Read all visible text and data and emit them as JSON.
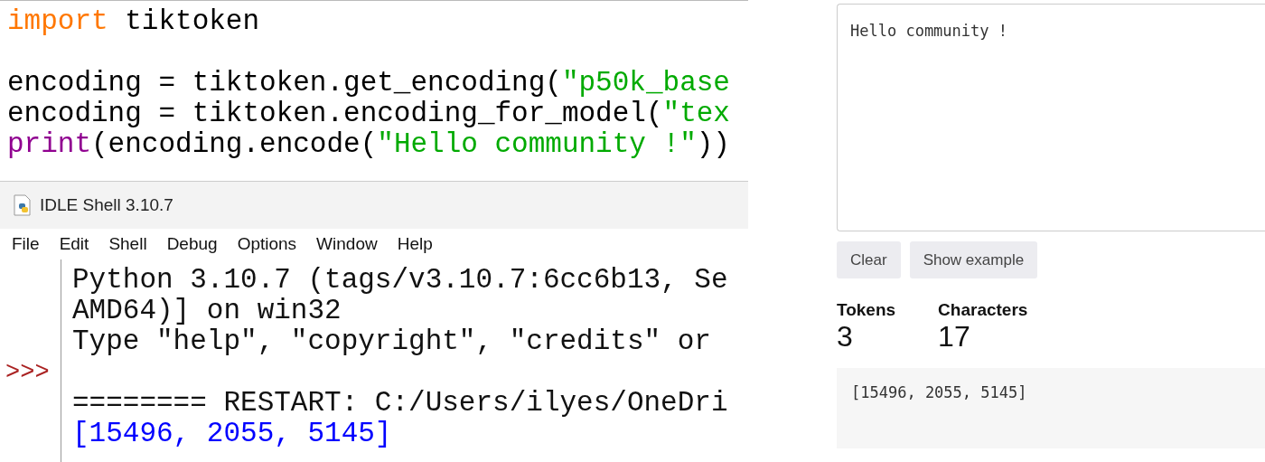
{
  "editor": {
    "lines": [
      {
        "kind": "code",
        "tokens": [
          {
            "kind": "keyword",
            "text": "import"
          },
          {
            "kind": "plain",
            "text": " tiktoken"
          }
        ]
      },
      {
        "kind": "blank"
      },
      {
        "kind": "code",
        "tokens": [
          {
            "kind": "plain",
            "text": "encoding = tiktoken.get_encoding("
          },
          {
            "kind": "string",
            "text": "\"p50k_base"
          }
        ]
      },
      {
        "kind": "code",
        "tokens": [
          {
            "kind": "plain",
            "text": "encoding = tiktoken.encoding_for_model("
          },
          {
            "kind": "string",
            "text": "\"tex"
          }
        ]
      },
      {
        "kind": "code",
        "tokens": [
          {
            "kind": "builtin",
            "text": "print"
          },
          {
            "kind": "plain",
            "text": "(encoding.encode("
          },
          {
            "kind": "string",
            "text": "\"Hello community !\""
          },
          {
            "kind": "plain",
            "text": "))"
          }
        ]
      }
    ]
  },
  "shell": {
    "title": "IDLE Shell 3.10.7",
    "menu": [
      "File",
      "Edit",
      "Shell",
      "Debug",
      "Options",
      "Window",
      "Help"
    ],
    "lines": [
      {
        "kind": "output",
        "text": "Python 3.10.7 (tags/v3.10.7:6cc6b13, Se"
      },
      {
        "kind": "output",
        "text": "AMD64)] on win32"
      },
      {
        "kind": "output",
        "text": "Type \"help\", \"copyright\", \"credits\" or"
      },
      {
        "kind": "prompt",
        "text": ">>>"
      },
      {
        "kind": "output",
        "text": "======== RESTART: C:/Users/ilyes/OneDri"
      },
      {
        "kind": "result",
        "text": "[15496, 2055, 5145]"
      }
    ]
  },
  "tokenizer": {
    "input": "Hello community !",
    "buttons": [
      "Clear",
      "Show example"
    ],
    "stats": [
      {
        "label": "Tokens",
        "value": "3"
      },
      {
        "label": "Characters",
        "value": "17"
      }
    ],
    "output": "[15496, 2055, 5145]"
  }
}
